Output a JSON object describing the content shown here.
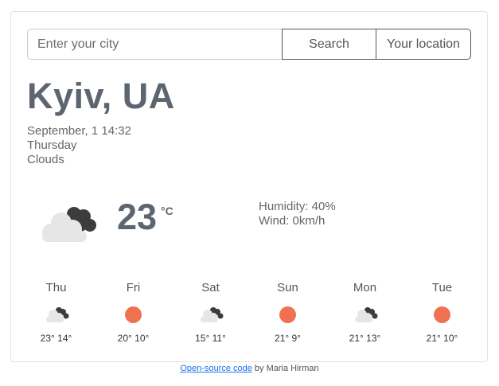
{
  "search": {
    "placeholder": "Enter your city",
    "value": "",
    "search_label": "Search",
    "location_label": "Your location"
  },
  "current": {
    "city": "Kyiv, UA",
    "date": "September, 1 14:32",
    "weekday": "Thursday",
    "description": "Clouds",
    "icon": "cloud-icon",
    "temperature": "23",
    "unit": "°C",
    "humidity": "Humidity: 40%",
    "wind": "Wind: 0km/h"
  },
  "forecast": [
    {
      "day": "Thu",
      "icon": "cloud-icon",
      "temps": "23° 14°"
    },
    {
      "day": "Fri",
      "icon": "sun-icon",
      "temps": "20° 10°"
    },
    {
      "day": "Sat",
      "icon": "cloud-icon",
      "temps": "15° 11°"
    },
    {
      "day": "Sun",
      "icon": "sun-icon",
      "temps": "21° 9°"
    },
    {
      "day": "Mon",
      "icon": "cloud-icon",
      "temps": "21° 13°"
    },
    {
      "day": "Tue",
      "icon": "sun-icon",
      "temps": "21° 10°"
    }
  ],
  "footer": {
    "link_text": "Open-source code",
    "suffix": " by Maria Hirman"
  },
  "colors": {
    "title": "#5d6670",
    "sun": "#f07152",
    "link": "#1a73e8"
  }
}
